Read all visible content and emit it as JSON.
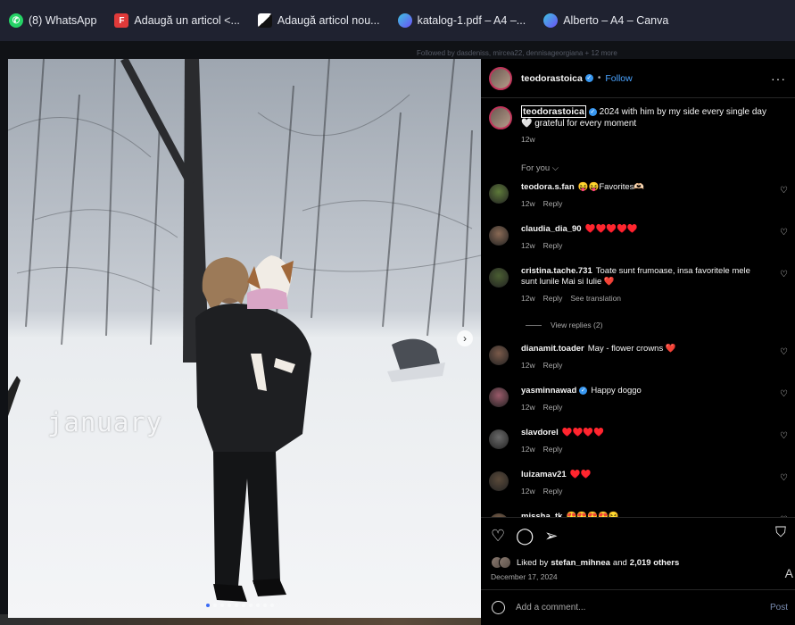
{
  "bookmarks": [
    {
      "label": "(8) WhatsApp",
      "icon": "whatsapp-icon",
      "color": "#25d366"
    },
    {
      "label": "Adaugă un articol <...",
      "icon": "f-logo-icon",
      "color": "#e03a3a"
    },
    {
      "label": "Adaugă articol nou...",
      "icon": "triangle-logo-icon",
      "color": "#ffffff"
    },
    {
      "label": "katalog-1.pdf – A4 –...",
      "icon": "canva-icon",
      "color": "#6c4ff5"
    },
    {
      "label": "Alberto – A4 – Canva",
      "icon": "canva-icon",
      "color": "#6c4ff5"
    }
  ],
  "followed_by": "Followed by dasdeniss, mircea22, dennisageorgiana + 12 more",
  "photo": {
    "overlay_text": "january",
    "slide_count": 10,
    "active_slide": 0
  },
  "post": {
    "username": "teodorastoica",
    "follow_label": "Follow",
    "caption": "2024 with him by my side every single day 🤍 grateful for every moment",
    "caption_age": "12w",
    "for_you_label": "For you ⌵"
  },
  "comments": [
    {
      "user": "teodora.s.fan",
      "verified": false,
      "text": "😝😝Favorites🫶🏻",
      "age": "12w",
      "reply": "Reply",
      "translate": ""
    },
    {
      "user": "claudia_dia_90",
      "verified": false,
      "text": "♥️♥️♥️♥️♥️",
      "age": "12w",
      "reply": "Reply",
      "translate": ""
    },
    {
      "user": "cristina.tache.731",
      "verified": false,
      "text": "Toate sunt frumoase, insa favoritele mele sunt lunile Mai si Iulie ❤️",
      "age": "12w",
      "reply": "Reply",
      "translate": "See translation"
    },
    {
      "user": "dianamit.toader",
      "verified": false,
      "text": "May - flower crowns ❤️",
      "age": "12w",
      "reply": "Reply",
      "translate": ""
    },
    {
      "user": "yasminnawad",
      "verified": true,
      "text": "Happy doggo",
      "age": "12w",
      "reply": "Reply",
      "translate": ""
    },
    {
      "user": "slavdorel",
      "verified": false,
      "text": "♥️♥️♥️♥️",
      "age": "12w",
      "reply": "Reply",
      "translate": ""
    },
    {
      "user": "luizamav21",
      "verified": false,
      "text": "♥️♥️",
      "age": "12w",
      "reply": "Reply",
      "translate": ""
    },
    {
      "user": "missha_tk",
      "verified": false,
      "text": "😍😍😍😍😝",
      "age": "",
      "reply": "",
      "translate": ""
    }
  ],
  "view_replies": "View replies (2)",
  "likes": {
    "prefix": "Liked by",
    "user": "stefan_mihnea",
    "middle": "and",
    "count": "2,019 others"
  },
  "date": "December 17, 2024",
  "add_comment_placeholder": "Add a comment...",
  "post_button": "Post",
  "side_glyph": "A"
}
